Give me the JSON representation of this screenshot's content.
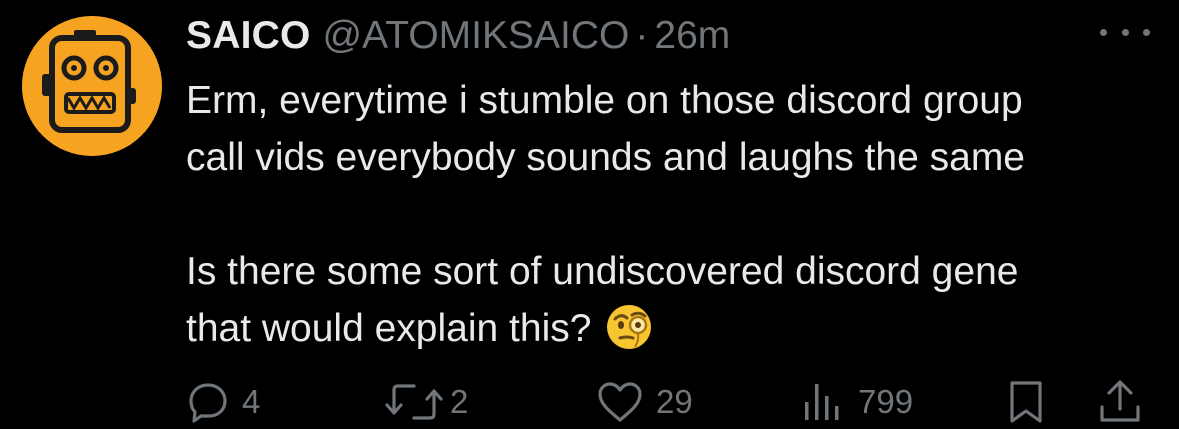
{
  "tweet": {
    "author": {
      "display_name": "SAICO",
      "handle": "@ATOMIKSAICO",
      "avatar_icon": "robot-face-icon",
      "avatar_color": "#f5a321"
    },
    "separator": "·",
    "time": "26m",
    "text_paragraphs": [
      [
        "Erm, everytime i stumble on those discord group",
        "call vids everybody sounds and laughs the same"
      ],
      [
        "Is there some sort of undiscovered discord gene",
        "that would explain this?"
      ]
    ],
    "emoji": "face-with-monocle-icon",
    "actions": {
      "replies": {
        "icon": "reply-icon",
        "count": "4"
      },
      "retweets": {
        "icon": "retweet-icon",
        "count": "2"
      },
      "likes": {
        "icon": "heart-icon",
        "count": "29"
      },
      "views": {
        "icon": "views-icon",
        "count": "799"
      },
      "bookmark": {
        "icon": "bookmark-icon"
      },
      "share": {
        "icon": "share-icon"
      }
    },
    "colors": {
      "background": "#000000",
      "primary_text": "#e7e9ea",
      "secondary_text": "#71767b"
    }
  }
}
